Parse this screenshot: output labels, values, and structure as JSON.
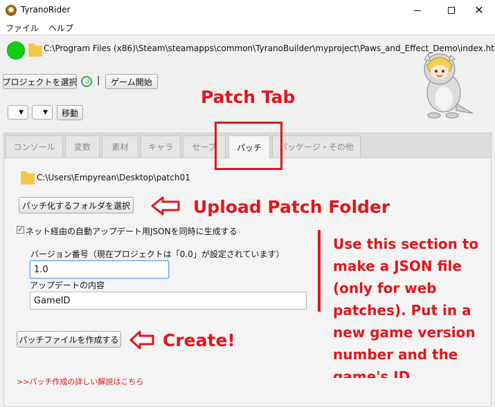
{
  "window": {
    "title": "TyranoRider",
    "menu": [
      "ファイル",
      "ヘルプ"
    ]
  },
  "toolbar": {
    "project_path": "C:\\Program Files (x86)\\Steam\\steamapps\\common\\TyranoBuilder\\myproject\\Paws_and_Effect_Demo\\index.html",
    "select_project_label": "プロジェクトを選択",
    "separator": "|",
    "start_game_label": "ゲーム開始",
    "combo_1": "▼",
    "combo_2": "▼",
    "move_label": "移動"
  },
  "tabs": [
    {
      "label": "コンソール",
      "active": false
    },
    {
      "label": "変数",
      "active": false
    },
    {
      "label": "素材",
      "active": false
    },
    {
      "label": "キャラ",
      "active": false
    },
    {
      "label": "セーブ",
      "active": false
    },
    {
      "label": "パッチ",
      "active": true
    },
    {
      "label": "パッケージ・その他",
      "active": false
    }
  ],
  "patch": {
    "folder_path": "C:\\Users\\Empyrean\\Desktop\\patch01",
    "select_folder_label": "パッチ化するフォルダを選択",
    "auto_json_checked": true,
    "auto_json_check_mark": "✓",
    "auto_json_label": "ネット経由の自動アップデート用JSONを同時に生成する",
    "version_label": "バージョン番号（現在プロジェクトは「0.0」が設定されています）",
    "version_value": "1.0",
    "update_label": "アップデートの内容",
    "update_value": "GameID",
    "create_label": "パッチファイルを作成する",
    "help_link": ">>パッチ作成の詳しい解説はこちら"
  },
  "annotations": {
    "patch_tab": "Patch Tab",
    "upload": "Upload Patch Folder",
    "create": "Create!",
    "note": "Use this section to make a JSON file (only for web patches). Put in a new game version number and the game's ID",
    "color": "#e0161c"
  }
}
